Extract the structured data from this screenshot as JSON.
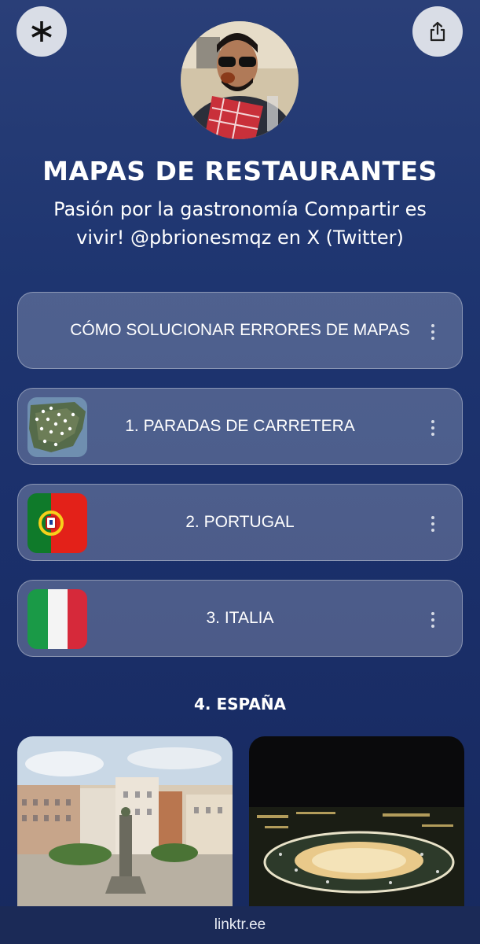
{
  "header": {
    "logo_icon": "linktree-asterisk-icon",
    "share_icon": "share-icon"
  },
  "profile": {
    "title": "MAPAS DE RESTAURANTES",
    "bio": "Pasión por la gastronomía Compartir es vivir! @pbrionesmqz en X (Twitter)"
  },
  "links": [
    {
      "label": "CÓMO SOLUCIONAR ERRORES DE MAPAS"
    },
    {
      "label": "1. PARADAS DE CARRETERA",
      "thumb": "map-thumbnail"
    },
    {
      "label": "2. PORTUGAL",
      "thumb": "portugal-flag"
    },
    {
      "label": "3. ITALIA",
      "thumb": "italy-flag"
    }
  ],
  "section": {
    "title": "4. ESPAÑA"
  },
  "footer": {
    "label": "linktr.ee"
  },
  "colors": {
    "background": "#1e3570",
    "card": "rgba(255,255,255,0.22)",
    "footer": "#1b2a57"
  }
}
